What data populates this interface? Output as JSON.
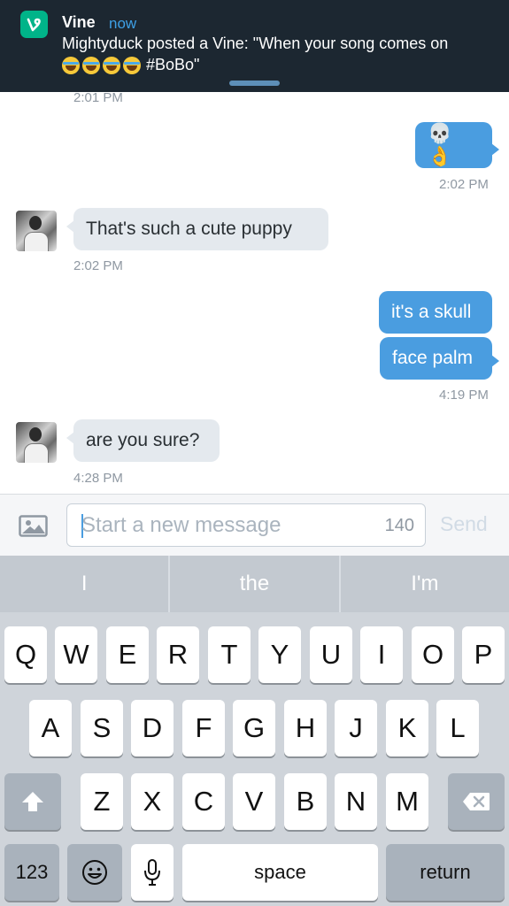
{
  "notification": {
    "app_name": "Vine",
    "time": "now",
    "message": "Mightyduck posted a Vine: \"When your song comes on",
    "message_end": "#BoBo\"",
    "emoji_icons": [
      "face-with-tears-of-joy-icon",
      "face-with-tears-of-joy-icon",
      "face-with-tears-of-joy-icon",
      "face-with-tears-of-joy-icon"
    ]
  },
  "chat": {
    "top_timestamp": "2:01 PM",
    "messages": [
      {
        "direction": "outgoing",
        "text": "💀 👌",
        "timestamp": "2:02 PM"
      },
      {
        "direction": "incoming",
        "text": "That's such a cute puppy",
        "timestamp": "2:02 PM"
      },
      {
        "direction": "outgoing",
        "text": "it's a skull"
      },
      {
        "direction": "outgoing",
        "text": "face palm",
        "timestamp": "4:19 PM"
      },
      {
        "direction": "incoming",
        "text": "are you sure?",
        "timestamp": "4:28 PM"
      }
    ]
  },
  "composer": {
    "placeholder": "Start a new message",
    "char_count": "140",
    "send_label": "Send",
    "image_icon": "image-icon"
  },
  "keyboard": {
    "suggestions": [
      "I",
      "the",
      "I'm"
    ],
    "row1": [
      "Q",
      "W",
      "E",
      "R",
      "T",
      "Y",
      "U",
      "I",
      "O",
      "P"
    ],
    "row2": [
      "A",
      "S",
      "D",
      "F",
      "G",
      "H",
      "J",
      "K",
      "L"
    ],
    "row3": [
      "Z",
      "X",
      "C",
      "V",
      "B",
      "N",
      "M"
    ],
    "numbers_label": "123",
    "space_label": "space",
    "return_label": "return",
    "shift_icon": "shift-icon",
    "delete_icon": "delete-icon",
    "emoji_icon": "emoji-icon",
    "mic_icon": "microphone-icon"
  }
}
